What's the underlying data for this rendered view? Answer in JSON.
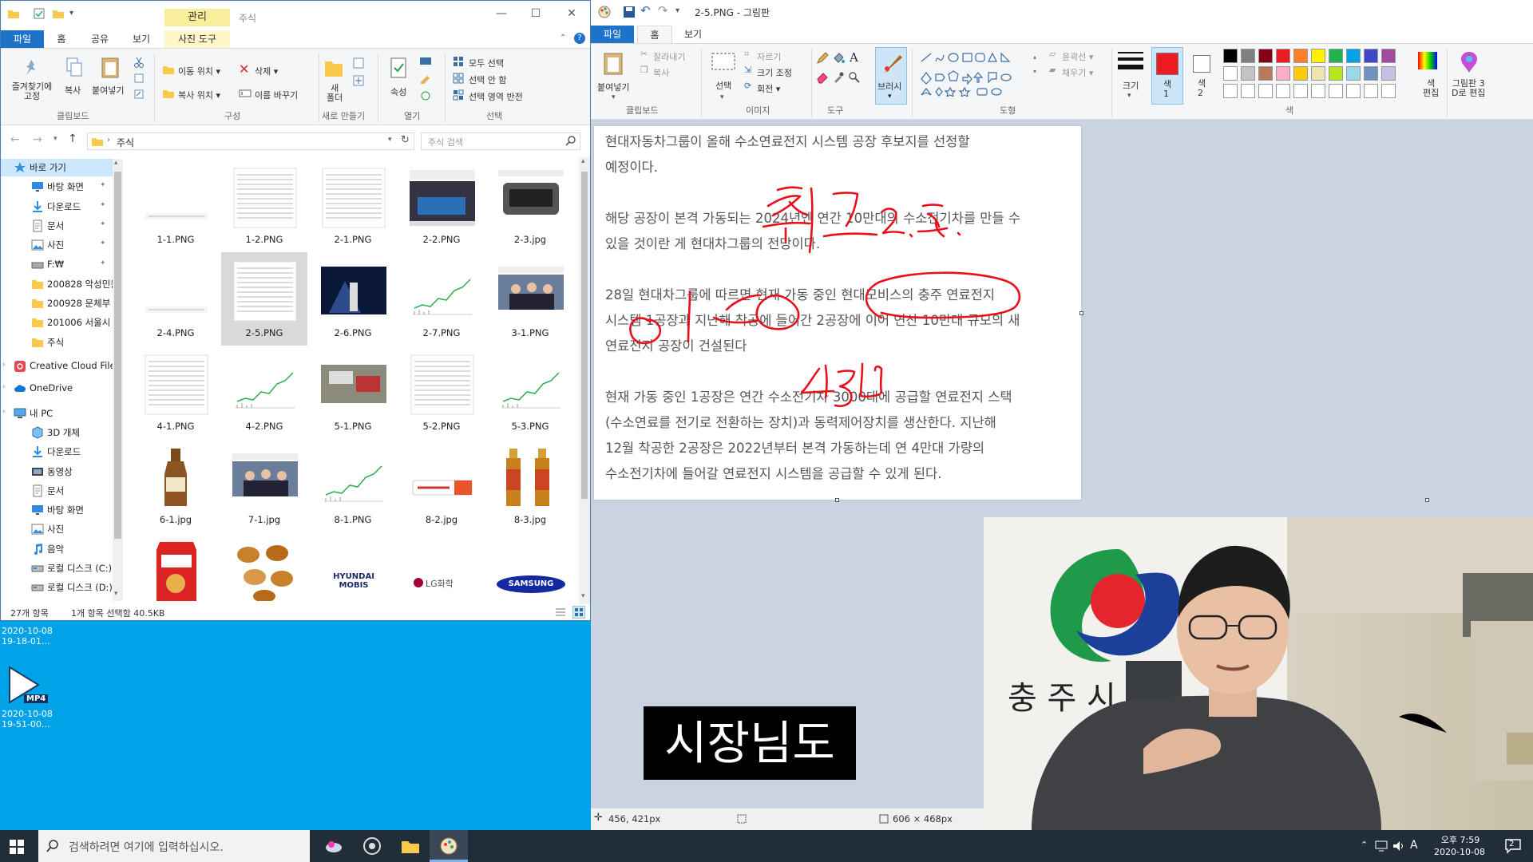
{
  "explorer": {
    "title": "주식",
    "context_tab": "관리",
    "tabs": [
      {
        "label": "파일"
      },
      {
        "label": "홈"
      },
      {
        "label": "공유"
      },
      {
        "label": "보기"
      },
      {
        "label": "사진 도구"
      }
    ],
    "ribbon": {
      "clipboard": {
        "pin": "즐겨찾기에\n고정",
        "copy": "복사",
        "paste": "붙여넣기",
        "caption": "클립보드"
      },
      "organize": {
        "move_to": "이동 위치 ▾",
        "copy_to": "복사 위치 ▾",
        "delete": "삭제 ▾",
        "rename": "이름 바꾸기",
        "caption": "구성"
      },
      "new": {
        "new_folder": "새\n폴더",
        "caption": "새로 만들기"
      },
      "open": {
        "properties": "속성",
        "caption": "열기"
      },
      "select": {
        "select_all": "모두 선택",
        "select_none": "선택 안 함",
        "invert": "선택 영역 반전",
        "caption": "선택"
      }
    },
    "address": "주식",
    "search_placeholder": "주식 검색",
    "nav": [
      {
        "label": "바로 가기",
        "icon": "star-icon"
      },
      {
        "label": "바탕 화면",
        "icon": "desktop-icon"
      },
      {
        "label": "다운로드",
        "icon": "download-icon"
      },
      {
        "label": "문서",
        "icon": "document-icon"
      },
      {
        "label": "사진",
        "icon": "picture-icon"
      },
      {
        "label": "F:₩",
        "icon": "drive-icon"
      },
      {
        "label": "200828 악성민원",
        "icon": "folder-icon"
      },
      {
        "label": "200928 문체부",
        "icon": "folder-icon"
      },
      {
        "label": "201006 서울시",
        "icon": "folder-icon"
      },
      {
        "label": "주식",
        "icon": "folder-icon"
      },
      {
        "label": "Creative Cloud Files",
        "icon": "creative-cloud-icon"
      },
      {
        "label": "OneDrive",
        "icon": "cloud-icon"
      },
      {
        "label": "내 PC",
        "icon": "computer-icon"
      },
      {
        "label": "3D 개체",
        "icon": "cube-icon"
      },
      {
        "label": "다운로드",
        "icon": "download-icon"
      },
      {
        "label": "동영상",
        "icon": "video-icon"
      },
      {
        "label": "문서",
        "icon": "document-icon"
      },
      {
        "label": "바탕 화면",
        "icon": "desktop-icon"
      },
      {
        "label": "사진",
        "icon": "picture-icon"
      },
      {
        "label": "음악",
        "icon": "music-icon"
      },
      {
        "label": "로컬 디스크 (C:)",
        "icon": "disk-icon"
      },
      {
        "label": "로컬 디스크 (D:)",
        "icon": "disk-icon"
      }
    ],
    "files": [
      {
        "name": "1-1.PNG"
      },
      {
        "name": "1-2.PNG"
      },
      {
        "name": "2-1.PNG"
      },
      {
        "name": "2-2.PNG"
      },
      {
        "name": "2-3.jpg"
      },
      {
        "name": "2-4.PNG"
      },
      {
        "name": "2-5.PNG"
      },
      {
        "name": "2-6.PNG"
      },
      {
        "name": "2-7.PNG"
      },
      {
        "name": "3-1.PNG"
      },
      {
        "name": "4-1.PNG"
      },
      {
        "name": "4-2.PNG"
      },
      {
        "name": "5-1.PNG"
      },
      {
        "name": "5-2.PNG"
      },
      {
        "name": "5-3.PNG"
      },
      {
        "name": "6-1.jpg"
      },
      {
        "name": "7-1.jpg"
      },
      {
        "name": "8-1.PNG"
      },
      {
        "name": "8-2.jpg"
      },
      {
        "name": "8-3.jpg"
      },
      {
        "name": ""
      },
      {
        "name": ""
      },
      {
        "name": ""
      },
      {
        "name": ""
      },
      {
        "name": ""
      }
    ],
    "thumb_texts": {
      "mobis": "HYUNDAI\nMOBIS",
      "lg": "LG화학",
      "samsung": "SAMSUNG"
    },
    "status": {
      "count": "27개 항목",
      "selected": "1개 항목 선택함 40.5KB"
    }
  },
  "desktop": {
    "file1": {
      "label": "2020-10-08\n19-18-01..."
    },
    "file2": {
      "label": "2020-10-08\n19-51-00...",
      "badge": "MP4"
    }
  },
  "paint": {
    "title": "2-5.PNG - 그림판",
    "tabs": [
      {
        "label": "파일"
      },
      {
        "label": "홈"
      },
      {
        "label": "보기"
      }
    ],
    "ribbon": {
      "paste": "붙여넣기",
      "cut": "잘라내기",
      "copy": "복사",
      "clipboard_caption": "클립보드",
      "select": "선택",
      "crop": "자르기",
      "resize": "크기 조정",
      "rotate": "회전 ▾",
      "image_caption": "이미지",
      "tools_caption": "도구",
      "brush": "브러시",
      "shapes_caption": "도형",
      "outline": "윤곽선 ▾",
      "fill": "채우기 ▾",
      "size": "크기",
      "color1": "색\n1",
      "color2": "색\n2",
      "edit_colors": "색\n편집",
      "paint3d": "그림판 3\nD로 편집",
      "colors_caption": "색"
    },
    "palette": [
      "#000000",
      "#7f7f7f",
      "#880015",
      "#ed1c24",
      "#ff7f27",
      "#fff200",
      "#22b14c",
      "#00a2e8",
      "#3f48cc",
      "#a349a4",
      "#ffffff",
      "#c3c3c3",
      "#b97a57",
      "#ffaec9",
      "#ffc90e",
      "#efe4b0",
      "#b5e61d",
      "#99d9ea",
      "#7092be",
      "#c8bfe7",
      "#ffffff",
      "#ffffff",
      "#ffffff",
      "#ffffff",
      "#ffffff",
      "#ffffff",
      "#ffffff",
      "#ffffff",
      "#ffffff",
      "#ffffff"
    ],
    "color1": "#ed1c24",
    "color2": "#ffffff",
    "canvas_text": [
      "현대자동차그룹이 올해 수소연료전지 시스템 공장 후보지를 선정할",
      "예정이다.",
      "",
      "해당 공장이 본격 가동되는 2024년엔 연간 10만대의 수소전기차를 만들 수",
      "있을 것이란 게 현대차그룹의 전망이다.",
      "",
      "28일 현대차그룹에 따르면 현재 가동 중인 현대모비스의 충주 연료전지",
      "시스템 1공장과 지난해 착공에 들어간 2공장에 이어 연산 10만대 규모의 새",
      "연료전지 공장이 건설된다",
      "",
      "현재 가동 중인 1공장은 연간 수소전기차 3000대에 공급할 연료전지 스택",
      "(수소연료를 전기로 전환하는 장치)과 동력제어장치를 생산한다. 지난해",
      "12월 착공한 2공장은 2022년부터 본격 가동하는데 연 4만대 가량의",
      "수소전기차에 들어갈 연료전지 시스템을 공급할 수 있게 된다."
    ],
    "status": {
      "cursor": "456, 421px",
      "size": "606 × 468px"
    }
  },
  "webcam": {
    "sign_text": "충  주  시"
  },
  "subtitle": "시장님도",
  "taskbar": {
    "search_placeholder": "검색하려면 여기에 입력하십시오.",
    "time": "오후 7:59",
    "date": "2020-10-08",
    "ime": "A",
    "notification_count": "2"
  },
  "colors": {
    "explorer_accent": "#1e73c8",
    "desktop": "#00a2e8",
    "taskbar": "#222d3a",
    "ink": "#e8101a"
  }
}
